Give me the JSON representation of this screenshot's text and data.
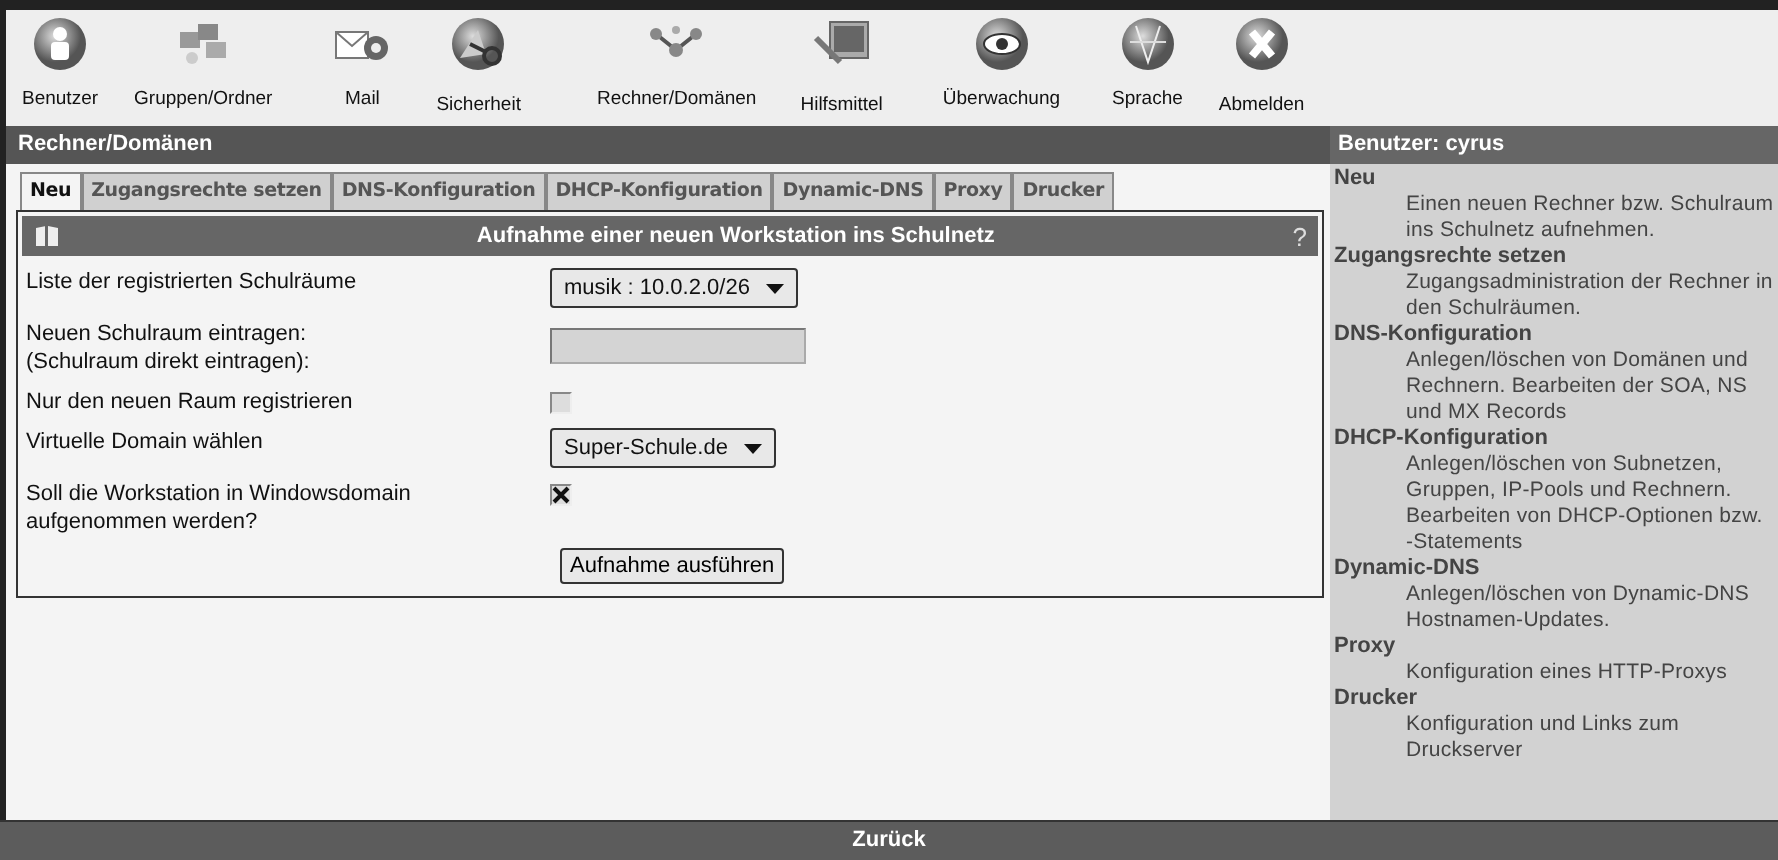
{
  "toolbar": [
    {
      "label": "Benutzer"
    },
    {
      "label": "Gruppen/Ordner"
    },
    {
      "label": "Mail"
    },
    {
      "label": "Sicherheit"
    },
    {
      "label": "Rechner/Domänen"
    },
    {
      "label": "Hilfsmittel"
    },
    {
      "label": "Überwachung"
    },
    {
      "label": "Sprache"
    },
    {
      "label": "Abmelden"
    }
  ],
  "section_title": "Rechner/Domänen",
  "user_title": "Benutzer: cyrus",
  "tabs": [
    {
      "label": "Neu",
      "selected": true
    },
    {
      "label": "Zugangsrechte setzen",
      "selected": false
    },
    {
      "label": "DNS-Konfiguration",
      "selected": false
    },
    {
      "label": "DHCP-Konfiguration",
      "selected": false
    },
    {
      "label": "Dynamic-DNS",
      "selected": false
    },
    {
      "label": "Proxy",
      "selected": false
    },
    {
      "label": "Drucker",
      "selected": false
    }
  ],
  "form": {
    "title": "Aufnahme einer neuen Workstation ins Schulnetz",
    "help": "?",
    "rows": [
      {
        "kind": "select",
        "label": "Liste der registrierten Schulräume",
        "value": "musik : 10.0.2.0/26"
      },
      {
        "kind": "text",
        "label": "Neuen Schulraum eintragen:\n(Schulraum direkt eintragen):"
      },
      {
        "kind": "checkbox",
        "label": "Nur den neuen Raum registrieren",
        "checked": false
      },
      {
        "kind": "select",
        "label": "Virtuelle Domain wählen",
        "value": "Super-Schule.de"
      },
      {
        "kind": "checkbox",
        "label": "Soll die Workstation in Windowsdomain\naufgenommen werden?",
        "checked": true
      }
    ],
    "submit": "Aufnahme ausführen"
  },
  "help_items": [
    {
      "title": "Neu",
      "text": "Einen neuen Rechner bzw. Schulraum ins Schulnetz aufnehmen."
    },
    {
      "title": "Zugangsrechte setzen",
      "text": "Zugangsadministration der Rechner in den Schulräumen."
    },
    {
      "title": "DNS-Konfiguration",
      "text": "Anlegen/löschen von Domänen und Rechnern. Bearbeiten der SOA, NS und MX Records"
    },
    {
      "title": "DHCP-Konfiguration",
      "text": "Anlegen/löschen von Subnetzen, Gruppen, IP-Pools und Rechnern. Bearbeiten von DHCP-Optionen bzw. -Statements"
    },
    {
      "title": "Dynamic-DNS",
      "text": "Anlegen/löschen von Dynamic-DNS Hostnamen-Updates."
    },
    {
      "title": "Proxy",
      "text": "Konfiguration eines HTTP-Proxys"
    },
    {
      "title": "Drucker",
      "text": "Konfiguration und Links zum Druckserver"
    }
  ],
  "footer": "Zurück"
}
